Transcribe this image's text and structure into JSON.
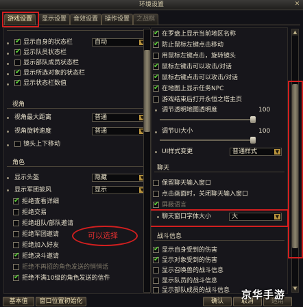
{
  "window": {
    "title": "环境设置"
  },
  "tabs": [
    {
      "label": "游戏设置",
      "active": true
    },
    {
      "label": "显示设置",
      "active": false
    },
    {
      "label": "音效设置",
      "active": false
    },
    {
      "label": "操作设置",
      "active": false
    },
    {
      "label": "之战棋",
      "active": false
    }
  ],
  "left": {
    "top_cut_label": "",
    "items_a": [
      {
        "label": "显示自身的状态栏",
        "checked": true,
        "select": "自动"
      },
      {
        "label": "显示队员状态栏",
        "checked": true
      },
      {
        "label": "显示部队成员状态栏",
        "checked": false
      },
      {
        "label": "显示所选对象的状态栏",
        "checked": true
      },
      {
        "label": "显示状态栏数值",
        "checked": true
      }
    ],
    "view_title": "视角",
    "view_items": [
      {
        "label": "视角最大距离",
        "select": "普通"
      },
      {
        "label": "视角旋转速度",
        "select": "普通"
      },
      {
        "label": "镜头上下移动",
        "checked": false
      }
    ],
    "char_title": "角色",
    "char_items": [
      {
        "label": "显示头盔",
        "select": "隐藏"
      },
      {
        "label": "显示军团披风",
        "select": "显示"
      },
      {
        "label": "拒绝查看详细",
        "checked": true
      },
      {
        "label": "拒绝交易",
        "checked": false
      },
      {
        "label": "拒绝组队/部队邀请",
        "checked": false
      },
      {
        "label": "拒绝军团邀请",
        "checked": false
      },
      {
        "label": "拒绝加入好友",
        "checked": false
      },
      {
        "label": "拒绝决斗邀请",
        "checked": true
      },
      {
        "label": "拒绝不再招的角色发送的悄悄话",
        "checked": false,
        "dim": true
      },
      {
        "label": "拒绝不满10级的角色发送的信件",
        "checked": true
      }
    ],
    "annotation": "可以选择"
  },
  "right": {
    "items_a": [
      {
        "label": "在罗盘上显示当前地区名称",
        "checked": true
      },
      {
        "label": "防止鼠标左键点击移动",
        "checked": true
      },
      {
        "label": "用鼠标左键点击，旋转镜头",
        "checked": false
      },
      {
        "label": "鼠标左键击可以攻击/对话",
        "checked": true
      },
      {
        "label": "鼠标右键点击可以攻击/对话",
        "checked": true
      },
      {
        "label": "在地图上显示任务NPC",
        "checked": true
      },
      {
        "label": "游戏结束后打开永恒之塔主页",
        "checked": false
      }
    ],
    "sliders": [
      {
        "label": "调节透明地图透明度",
        "value": "100",
        "level": 1.0
      },
      {
        "label": "调节UI大小",
        "value": "100",
        "level": 1.0
      }
    ],
    "ui_style": {
      "label": "UI样式变更",
      "select": "普通样式"
    },
    "chat_title": "聊天",
    "chat_items": [
      {
        "label": "保留聊天输入窗口",
        "checked": false
      },
      {
        "label": "点击画面时，关闭聊天输入窗口",
        "checked": false
      },
      {
        "label": "屏蔽语言",
        "checked": true,
        "dim": true
      }
    ],
    "font_size": {
      "label": "聊天窗口字体大小",
      "select": "大"
    },
    "battle_title": "战斗信息",
    "battle_items": [
      {
        "label": "显示自身受到的伤害",
        "checked": true
      },
      {
        "label": "显示对象受到的伤害",
        "checked": true
      },
      {
        "label": "显示召唤兽的战斗信息",
        "checked": false
      },
      {
        "label": "显示队员的战斗信息",
        "checked": false
      },
      {
        "label": "显示部队成员的战斗信息",
        "checked": false
      }
    ]
  },
  "footer": {
    "default_btn": "基本值",
    "reset_pos_btn": "窗口位置初始化",
    "ok_btn": "确认",
    "cancel_btn": "取消",
    "apply_btn": "适用"
  },
  "watermark": "京华手游"
}
